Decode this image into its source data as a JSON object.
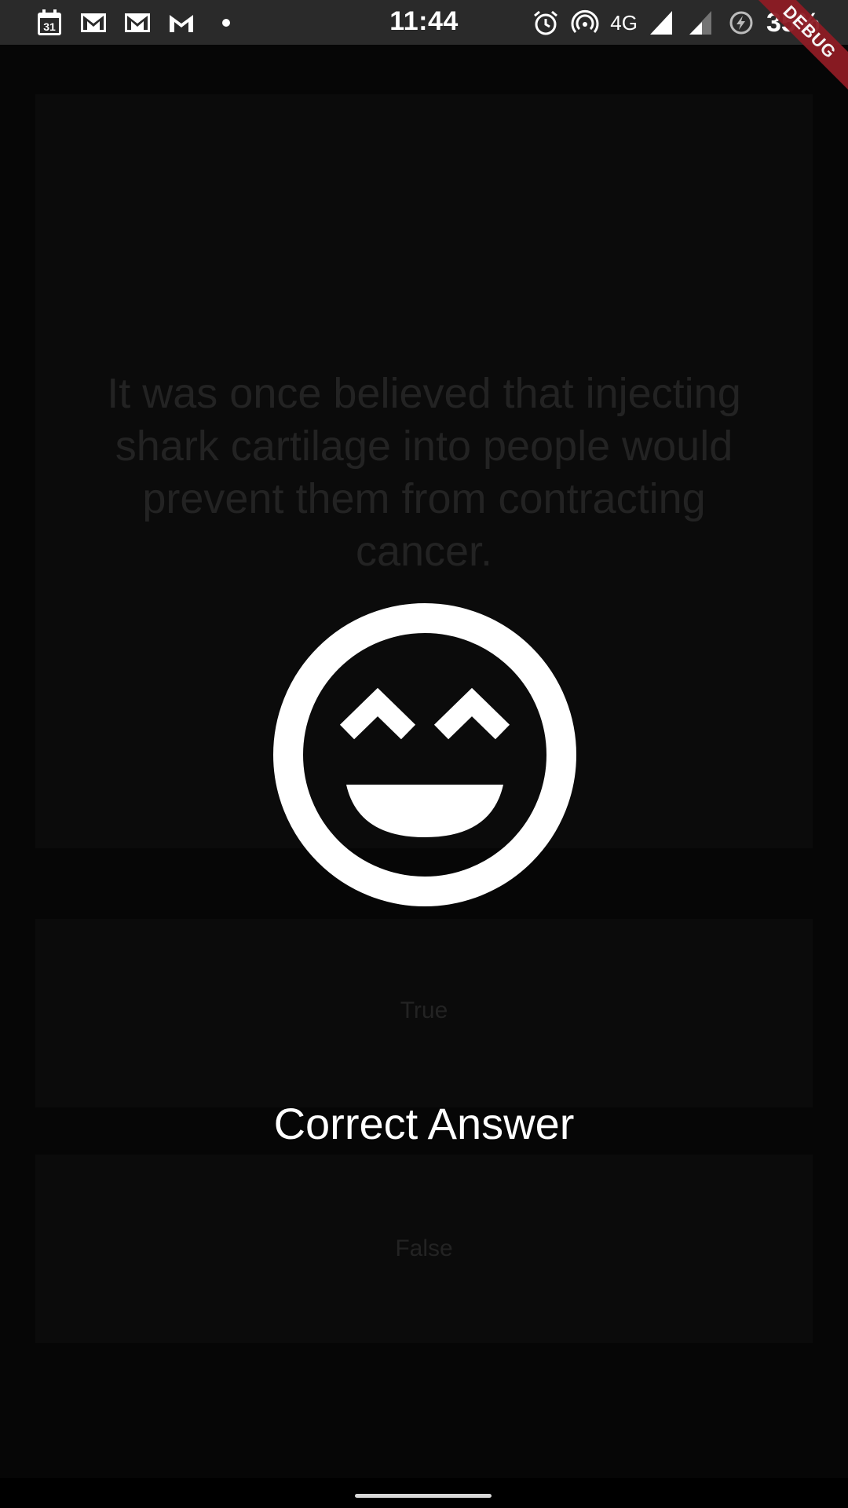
{
  "status_bar": {
    "time": "11:44",
    "network": "4G",
    "battery": "35%",
    "left_icons": [
      "calendar-icon",
      "gmail-icon",
      "gmail-icon",
      "gmail-icon",
      "dot-icon"
    ],
    "right_icons": [
      "alarm-icon",
      "hotspot-icon",
      "signal-icon",
      "signal-icon",
      "battery-saver-icon"
    ],
    "calendar_day": "31"
  },
  "debug_banner": "DEBUG",
  "quiz": {
    "question": "It was once believed that injecting shark cartilage into people would prevent them from contracting cancer.",
    "options": {
      "true_label": "True",
      "false_label": "False"
    }
  },
  "result": {
    "icon": "laughing-face-icon",
    "message": "Correct Answer"
  },
  "colors": {
    "background": "#060606",
    "panel": "#0b0b0b",
    "dimmed_text": "#232323",
    "result_text": "#ffffff",
    "status_bar": "#2a2a2a",
    "debug_ribbon": "#8e1c24"
  }
}
